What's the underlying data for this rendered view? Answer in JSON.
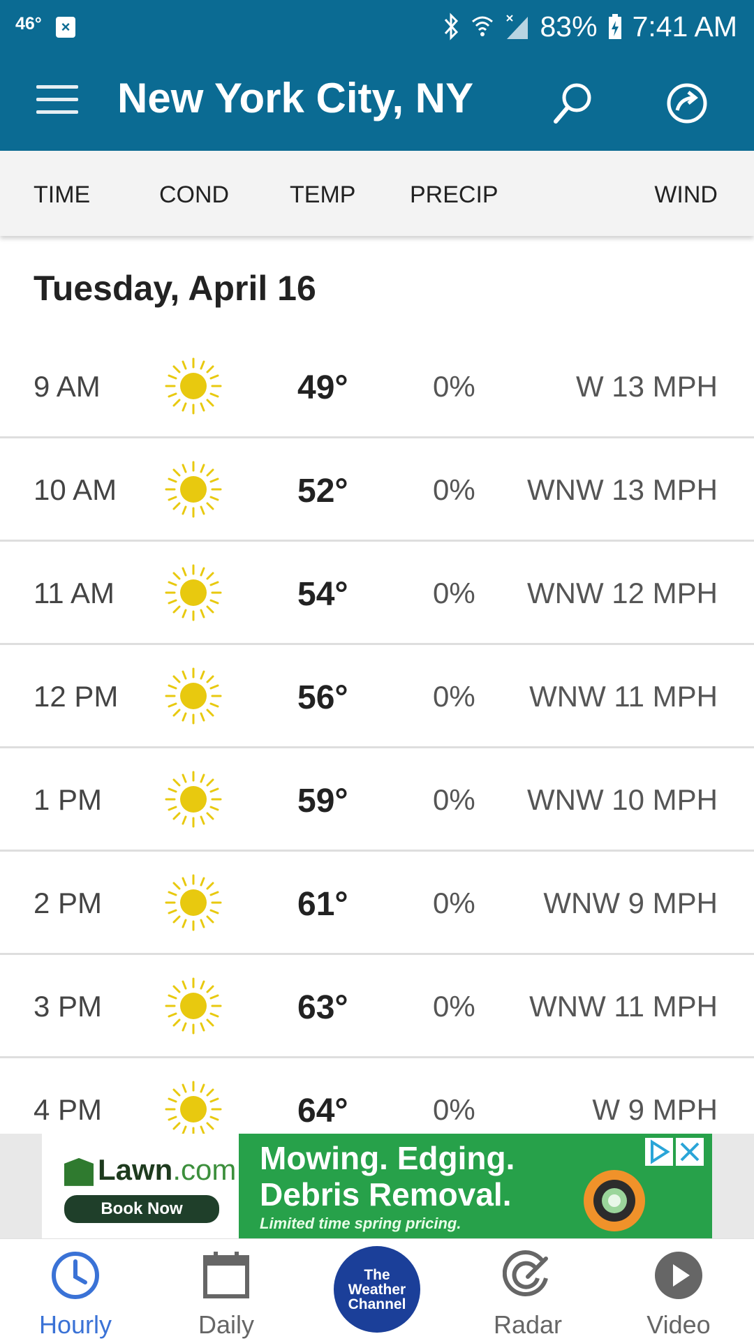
{
  "status_bar": {
    "temperature": "46°",
    "battery": "83%",
    "time": "7:41 AM"
  },
  "app_bar": {
    "title": "New York City, NY"
  },
  "columns": [
    "TIME",
    "COND",
    "TEMP",
    "PRECIP",
    "WIND"
  ],
  "date_heading": "Tuesday, April 16",
  "hours": [
    {
      "time": "9 AM",
      "condition": "sunny-icon",
      "temp": "49°",
      "precip": "0%",
      "wind": "W 13 MPH"
    },
    {
      "time": "10 AM",
      "condition": "sunny-icon",
      "temp": "52°",
      "precip": "0%",
      "wind": "WNW 13 MPH"
    },
    {
      "time": "11 AM",
      "condition": "sunny-icon",
      "temp": "54°",
      "precip": "0%",
      "wind": "WNW 12 MPH"
    },
    {
      "time": "12 PM",
      "condition": "sunny-icon",
      "temp": "56°",
      "precip": "0%",
      "wind": "WNW 11 MPH"
    },
    {
      "time": "1 PM",
      "condition": "sunny-icon",
      "temp": "59°",
      "precip": "0%",
      "wind": "WNW 10 MPH"
    },
    {
      "time": "2 PM",
      "condition": "sunny-icon",
      "temp": "61°",
      "precip": "0%",
      "wind": "WNW 9 MPH"
    },
    {
      "time": "3 PM",
      "condition": "sunny-icon",
      "temp": "63°",
      "precip": "0%",
      "wind": "WNW 11 MPH"
    },
    {
      "time": "4 PM",
      "condition": "sunny-icon",
      "temp": "64°",
      "precip": "0%",
      "wind": "W 9 MPH"
    }
  ],
  "ad": {
    "brand_name": "Lawn",
    "brand_suffix": ".com",
    "book_label": "Book Now",
    "headline_1": "Mowing. Edging.",
    "headline_2": "Debris Removal.",
    "subline": "Limited time spring pricing."
  },
  "bottom_nav": {
    "items": [
      {
        "label": "Hourly",
        "icon": "clock-icon",
        "active": true
      },
      {
        "label": "Daily",
        "icon": "calendar-icon",
        "active": false
      },
      {
        "label": "Radar",
        "icon": "radar-icon",
        "active": false
      },
      {
        "label": "Video",
        "icon": "play-icon",
        "active": false
      }
    ],
    "center_logo": "The\nWeather\nChannel"
  },
  "colors": {
    "brand_blue": "#0b6b93",
    "active_tab": "#3a72d6",
    "sun_yellow": "#e8c90f",
    "ad_green": "#27a14a",
    "twc_blue": "#1b3f99"
  }
}
